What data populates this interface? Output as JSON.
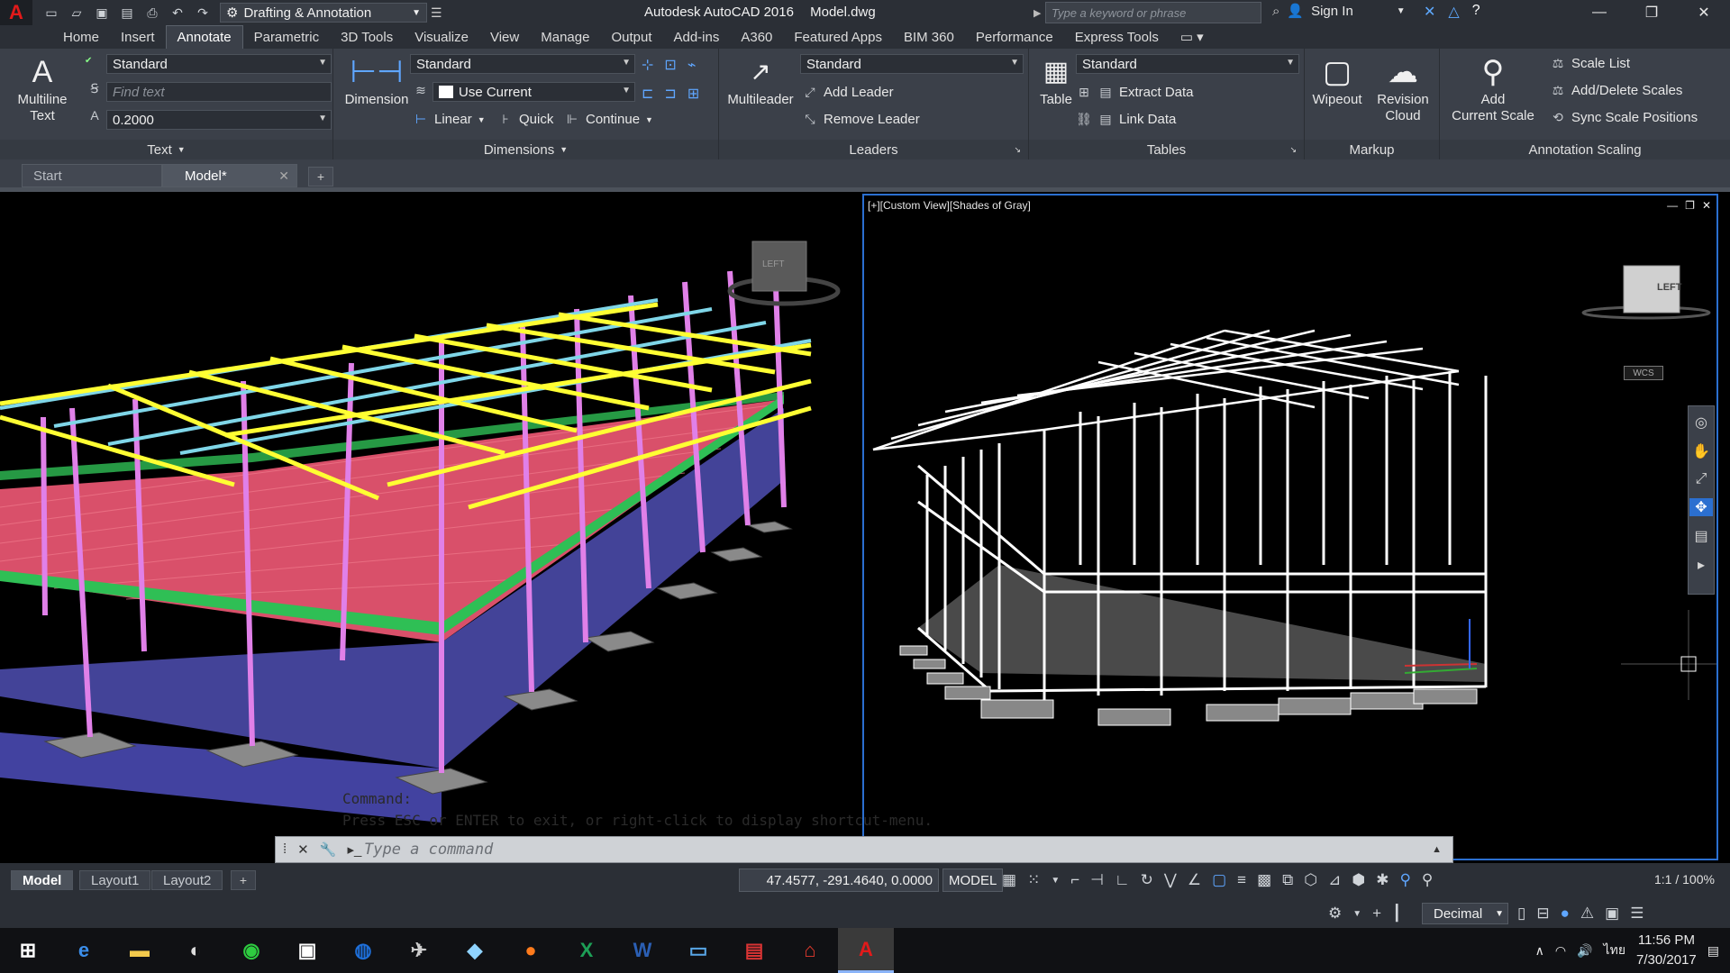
{
  "titlebar": {
    "logo": "A",
    "workspace": "Drafting & Annotation",
    "app_name": "Autodesk AutoCAD 2016",
    "doc_name": "Model.dwg",
    "search_placeholder": "Type a keyword or phrase",
    "signin": "Sign In"
  },
  "menu": {
    "tabs": [
      "Home",
      "Insert",
      "Annotate",
      "Parametric",
      "3D Tools",
      "Visualize",
      "View",
      "Manage",
      "Output",
      "Add-ins",
      "A360",
      "Featured Apps",
      "BIM 360",
      "Performance",
      "Express Tools"
    ],
    "active": "Annotate"
  },
  "ribbon": {
    "text_panel": {
      "title": "Text",
      "multiline_label_1": "Multiline",
      "multiline_label_2": "Text",
      "style_value": "Standard",
      "find_placeholder": "Find text",
      "height_value": "0.2000"
    },
    "dimensions_panel": {
      "title": "Dimensions",
      "dimension_label": "Dimension",
      "style_value": "Standard",
      "layer_value": "Use Current",
      "linear": "Linear",
      "quick": "Quick",
      "continue": "Continue"
    },
    "leaders_panel": {
      "title": "Leaders",
      "multileader_label": "Multileader",
      "style_value": "Standard",
      "add_leader": "Add Leader",
      "remove_leader": "Remove Leader"
    },
    "tables_panel": {
      "title": "Tables",
      "table_label": "Table",
      "style_value": "Standard",
      "extract_data": "Extract Data",
      "link_data": "Link Data"
    },
    "markup_panel": {
      "title": "Markup",
      "wipeout": "Wipeout",
      "revision_cloud_1": "Revision",
      "revision_cloud_2": "Cloud"
    },
    "annotation_scaling_panel": {
      "title": "Annotation Scaling",
      "add_scale_1": "Add",
      "add_scale_2": "Current Scale",
      "scale_list": "Scale List",
      "add_delete_scales": "Add/Delete Scales",
      "sync_scale_positions": "Sync Scale Positions"
    }
  },
  "doc_tabs": {
    "start": "Start",
    "model": "Model*"
  },
  "viewport_right": {
    "label": "[+][Custom View][Shades of Gray]",
    "viewcube_face": "LEFT",
    "wcs": "WCS"
  },
  "viewport_left": {
    "viewcube_face": "LEFT"
  },
  "command": {
    "ghost_line_1": "Command:",
    "ghost_line_2": "Press ESC or ENTER to exit, or right-click to display shortcut-menu.",
    "prompt": "Type a command"
  },
  "status": {
    "layout_tabs": [
      "Model",
      "Layout1",
      "Layout2"
    ],
    "coords": "47.4577, -291.4640, 0.0000",
    "space": "MODEL",
    "scale": "1:1 / 100%",
    "units": "Decimal"
  },
  "taskbar": {
    "time": "11:56 PM",
    "date": "7/30/2017",
    "lang": "ไทย"
  },
  "colors": {
    "accent": "#2b6fd0",
    "roof_purlin": "#ffff33",
    "floor": "#e8566a",
    "walls": "#4a4aa8",
    "columns": "#e080e8",
    "beams": "#33cc55"
  }
}
